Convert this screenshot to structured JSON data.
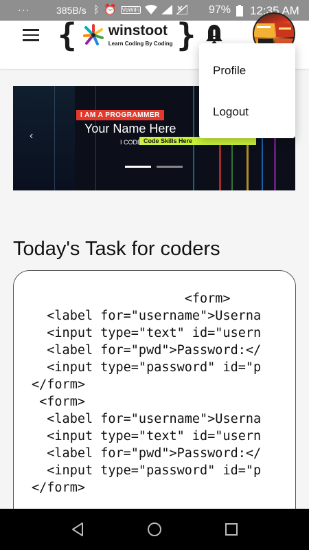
{
  "status_bar": {
    "dots": "···",
    "speed": "385B/s",
    "vowifi": "VoWiFi",
    "battery": "97%",
    "time": "12:35 AM"
  },
  "header": {
    "brand_name": "winstoot",
    "brand_tagline": "Learn Coding By Coding"
  },
  "menu": {
    "items": [
      {
        "label": "Profile"
      },
      {
        "label": "Logout"
      }
    ]
  },
  "banner": {
    "tag": "I AM A PROGRAMMER",
    "headline": "Your Name Here",
    "i_code": "I CODE",
    "skills": "Code Skills Here",
    "active_slide": 1,
    "slide_count": 2
  },
  "task": {
    "title": "Today's Task for coders",
    "code": "                    <form>\n  <label for=\"username\">Userna\n  <input type=\"text\" id=\"usern\n  <label for=\"pwd\">Password:</\n  <input type=\"password\" id=\"p\n</form>\n <form>\n  <label for=\"username\">Userna\n  <input type=\"text\" id=\"usern\n  <label for=\"pwd\">Password:</\n  <input type=\"password\" id=\"p\n</form>"
  },
  "colors": {
    "status_bar": "#8f8f8f",
    "banner_bg": "#0c0f1a",
    "banner_tag": "#e3382b",
    "banner_skills": "#c9f23a",
    "nav_bar": "#000000"
  },
  "icons": [
    "menu-icon",
    "winstoot-logo-icon",
    "notification-bell-icon",
    "user-avatar",
    "chevron-left-icon",
    "chevron-right-icon",
    "back-icon",
    "home-icon",
    "recents-icon"
  ]
}
